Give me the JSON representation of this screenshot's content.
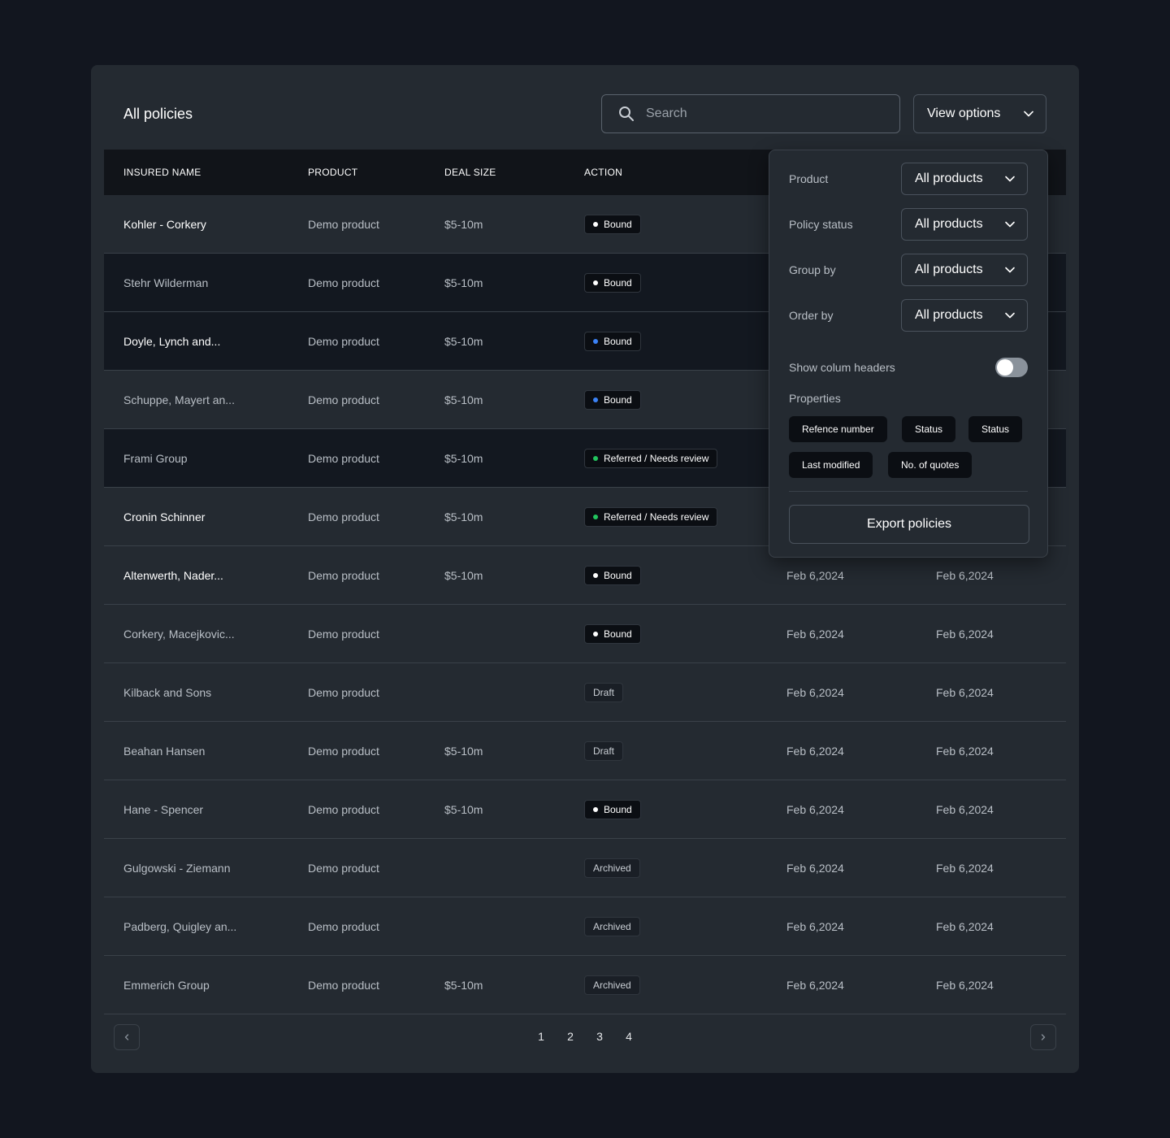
{
  "header": {
    "title": "All policies",
    "search_placeholder": "Search",
    "view_options_label": "View options"
  },
  "table": {
    "columns": [
      "INSURED NAME",
      "PRODUCT",
      "DEAL SIZE",
      "ACTION"
    ],
    "rows": [
      {
        "name": "Kohler - Corkery",
        "product": "Demo product",
        "deal": "$5-10m",
        "status": "Bound",
        "dot": "#ffffff",
        "date1": "",
        "date2": ""
      },
      {
        "name": "Stehr Wilderman",
        "product": "Demo product",
        "deal": "$5-10m",
        "status": "Bound",
        "dot": "#ffffff",
        "date1": "",
        "date2": ""
      },
      {
        "name": "Doyle, Lynch and...",
        "product": "Demo product",
        "deal": "$5-10m",
        "status": "Bound",
        "dot": "#3b82f6",
        "date1": "",
        "date2": ""
      },
      {
        "name": "Schuppe, Mayert an...",
        "product": "Demo product",
        "deal": "$5-10m",
        "status": "Bound",
        "dot": "#3b82f6",
        "date1": "",
        "date2": ""
      },
      {
        "name": "Frami Group",
        "product": "Demo product",
        "deal": "$5-10m",
        "status": "Referred / Needs review",
        "dot": "#22c55e",
        "date1": "",
        "date2": ""
      },
      {
        "name": "Cronin Schinner",
        "product": "Demo product",
        "deal": "$5-10m",
        "status": "Referred / Needs review",
        "dot": "#22c55e",
        "date1": "",
        "date2": ""
      },
      {
        "name": "Altenwerth, Nader...",
        "product": "Demo product",
        "deal": "$5-10m",
        "status": "Bound",
        "dot": "#ffffff",
        "date1": "Feb 6,2024",
        "date2": "Feb 6,2024"
      },
      {
        "name": "Corkery, Macejkovic...",
        "product": "Demo product",
        "deal": "",
        "status": "Bound",
        "dot": "#ffffff",
        "date1": "Feb 6,2024",
        "date2": "Feb 6,2024"
      },
      {
        "name": "Kilback and Sons",
        "product": "Demo product",
        "deal": "",
        "status": "Draft",
        "dot": "",
        "date1": "Feb 6,2024",
        "date2": "Feb 6,2024"
      },
      {
        "name": "Beahan Hansen",
        "product": "Demo product",
        "deal": "$5-10m",
        "status": "Draft",
        "dot": "",
        "date1": "Feb 6,2024",
        "date2": "Feb 6,2024"
      },
      {
        "name": "Hane - Spencer",
        "product": "Demo product",
        "deal": "$5-10m",
        "status": "Bound",
        "dot": "#ffffff",
        "date1": "Feb 6,2024",
        "date2": "Feb 6,2024"
      },
      {
        "name": "Gulgowski - Ziemann",
        "product": "Demo product",
        "deal": "",
        "status": "Archived",
        "dot": "",
        "date1": "Feb 6,2024",
        "date2": "Feb 6,2024"
      },
      {
        "name": "Padberg, Quigley an...",
        "product": "Demo product",
        "deal": "",
        "status": "Archived",
        "dot": "",
        "date1": "Feb 6,2024",
        "date2": "Feb 6,2024"
      },
      {
        "name": "Emmerich Group",
        "product": "Demo product",
        "deal": "$5-10m",
        "status": "Archived",
        "dot": "",
        "date1": "Feb 6,2024",
        "date2": "Feb 6,2024"
      }
    ]
  },
  "pagination": {
    "pages": [
      "1",
      "2",
      "3",
      "4"
    ],
    "prev_icon": "chevron-left-icon",
    "next_icon": "chevron-right-icon"
  },
  "view_options": {
    "filters": [
      {
        "label": "Product",
        "value": "All products"
      },
      {
        "label": "Policy status",
        "value": "All products"
      },
      {
        "label": "Group by",
        "value": "All products"
      },
      {
        "label": "Order by",
        "value": "All products"
      }
    ],
    "show_headers_label": "Show colum headers",
    "show_headers_on": false,
    "properties_label": "Properties",
    "properties": [
      "Refence number",
      "Status",
      "Status",
      "Last modified",
      "No. of quotes"
    ],
    "export_label": "Export policies"
  },
  "colors": {
    "background": "#12161f",
    "card": "#242a31",
    "header_row": "#111419",
    "dark_row": "#131820",
    "badge_bg": "#0b0e13",
    "bound_dot_blue": "#3b82f6",
    "review_dot_green": "#22c55e"
  }
}
